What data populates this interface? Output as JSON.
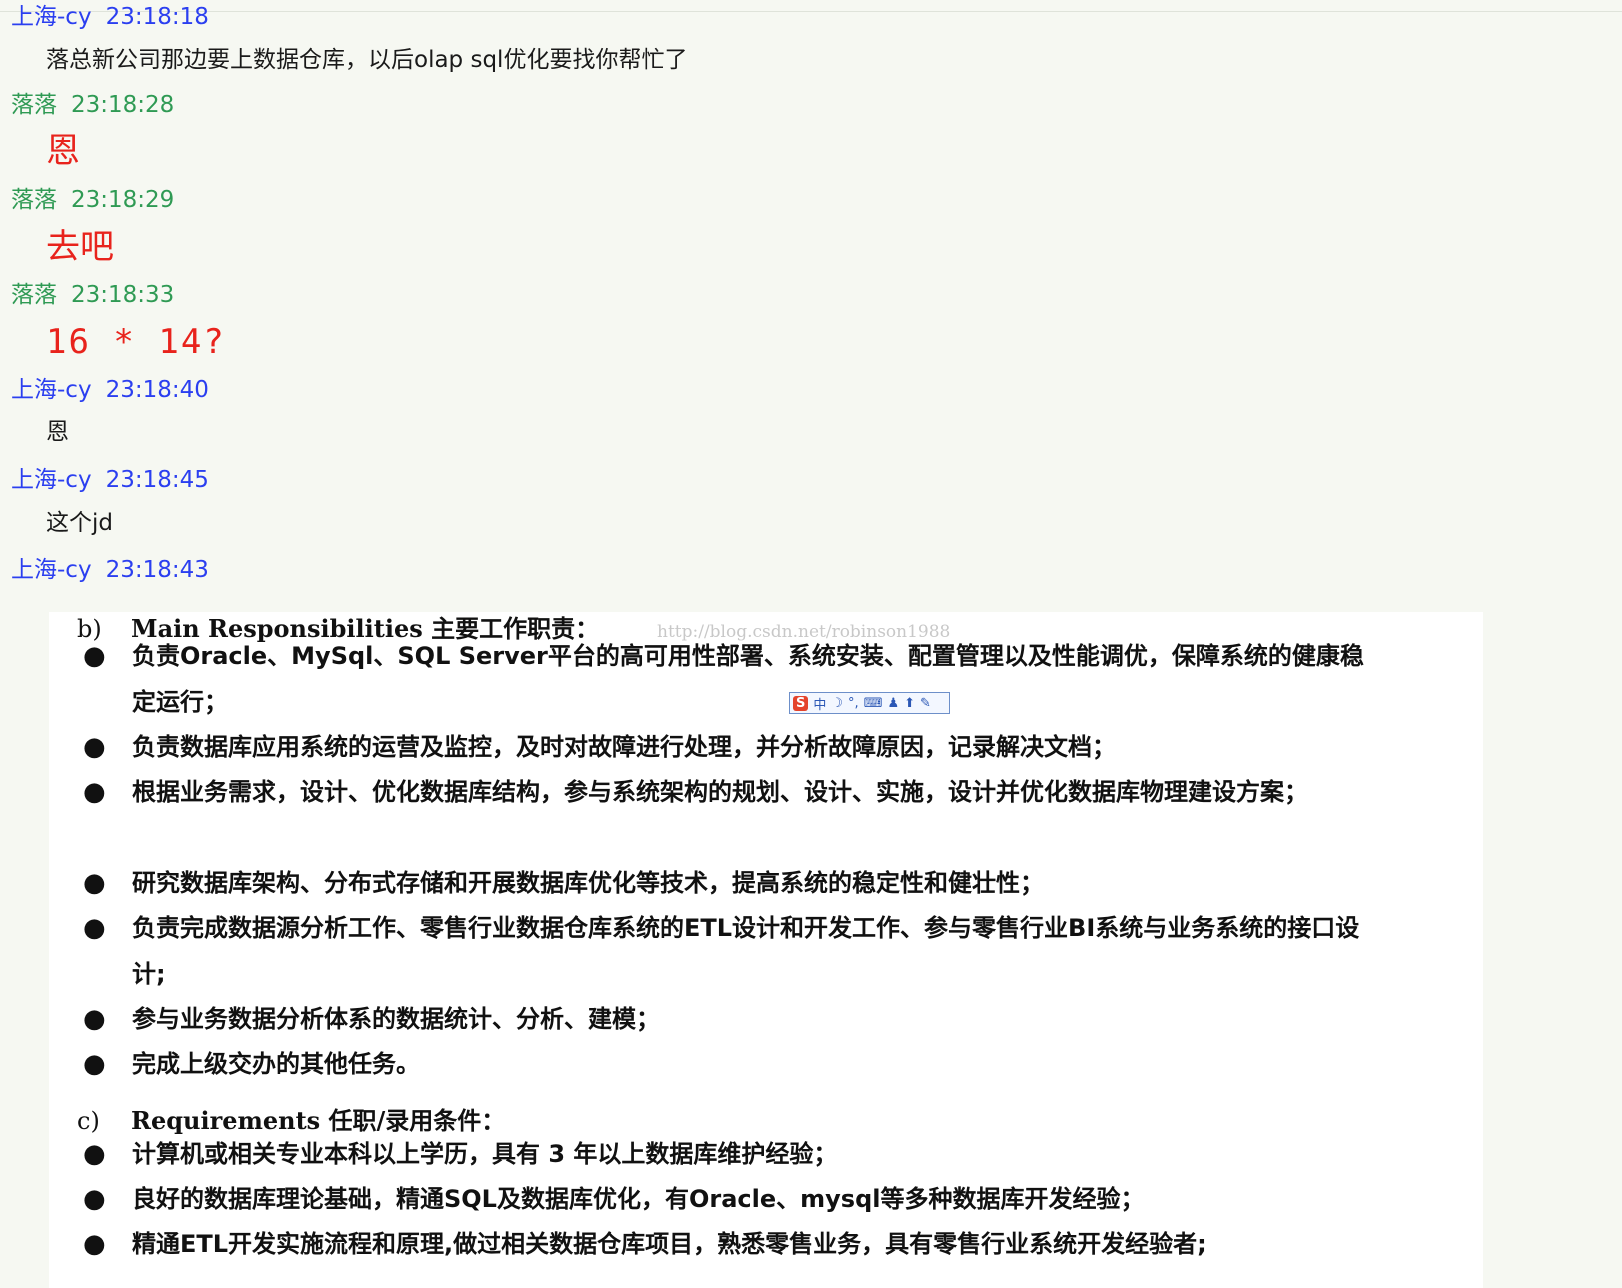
{
  "messages": [
    {
      "sender": "上海-cy",
      "time": "23:18:18",
      "text": "落总新公司那边要上数据仓库，以后olap sql优化要找你帮忙了",
      "style": "normal",
      "color": "blue"
    },
    {
      "sender": "落落",
      "time": "23:18:28",
      "text": "恩",
      "style": "red",
      "color": "green"
    },
    {
      "sender": "落落",
      "time": "23:18:29",
      "text": "去吧",
      "style": "red",
      "color": "green"
    },
    {
      "sender": "落落",
      "time": "23:18:33",
      "text": "16 * 14?",
      "style": "redbig",
      "color": "green"
    },
    {
      "sender": "上海-cy",
      "time": "23:18:40",
      "text": "恩",
      "style": "normal",
      "color": "blue"
    },
    {
      "sender": "上海-cy",
      "time": "23:18:45",
      "text": "这个jd",
      "style": "normal",
      "color": "blue"
    },
    {
      "sender": "上海-cy",
      "time": "23:18:43",
      "text": "",
      "style": "image",
      "color": "blue"
    }
  ],
  "document": {
    "watermark": "http://blog.csdn.net/robinson1988",
    "ime_toolbar": {
      "logo": "S",
      "mode": "中"
    },
    "section_b": {
      "label": "b)",
      "title": "Main Responsibilities 主要工作职责："
    },
    "responsibilities": [
      "负责Oracle、MySql、SQL Server平台的高可用性部署、系统安装、配置管理以及性能调优，保障系统的健康稳定运行；",
      "负责数据库应用系统的运营及监控，及时对故障进行处理，并分析故障原因，记录解决文档；",
      "根据业务需求，设计、优化数据库结构，参与系统架构的规划、设计、实施，设计并优化数据库物理建设方案；",
      "研究数据库架构、分布式存储和开展数据库优化等技术，提高系统的稳定性和健壮性；",
      "负责完成数据源分析工作、零售行业数据仓库系统的ETL设计和开发工作、参与零售行业BI系统与业务系统的接口设计;",
      "参与业务数据分析体系的数据统计、分析、建模；",
      "完成上级交办的其他任务。"
    ],
    "section_c": {
      "label": "c)",
      "title": "Requirements 任职/录用条件："
    },
    "requirements": [
      "计算机或相关专业本科以上学历，具有 3 年以上数据库维护经验；",
      "良好的数据库理论基础，精通SQL及数据库优化，有Oracle、mysql等多种数据库开发经验；",
      "精通ETL开发实施流程和原理,做过相关数据仓库项目，熟悉零售业务，具有零售行业系统开发经验者;"
    ]
  }
}
